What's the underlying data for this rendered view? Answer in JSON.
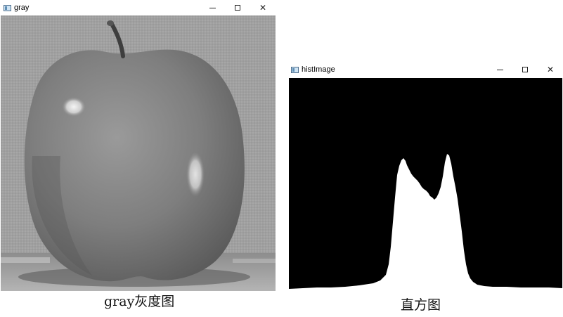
{
  "window_gray": {
    "title": "gray"
  },
  "window_hist": {
    "title": "histImage"
  },
  "captions": {
    "gray": "gray灰度图",
    "hist": "直方图"
  },
  "colors": {
    "hist_background": "#000000",
    "hist_fill": "#ffffff"
  }
}
